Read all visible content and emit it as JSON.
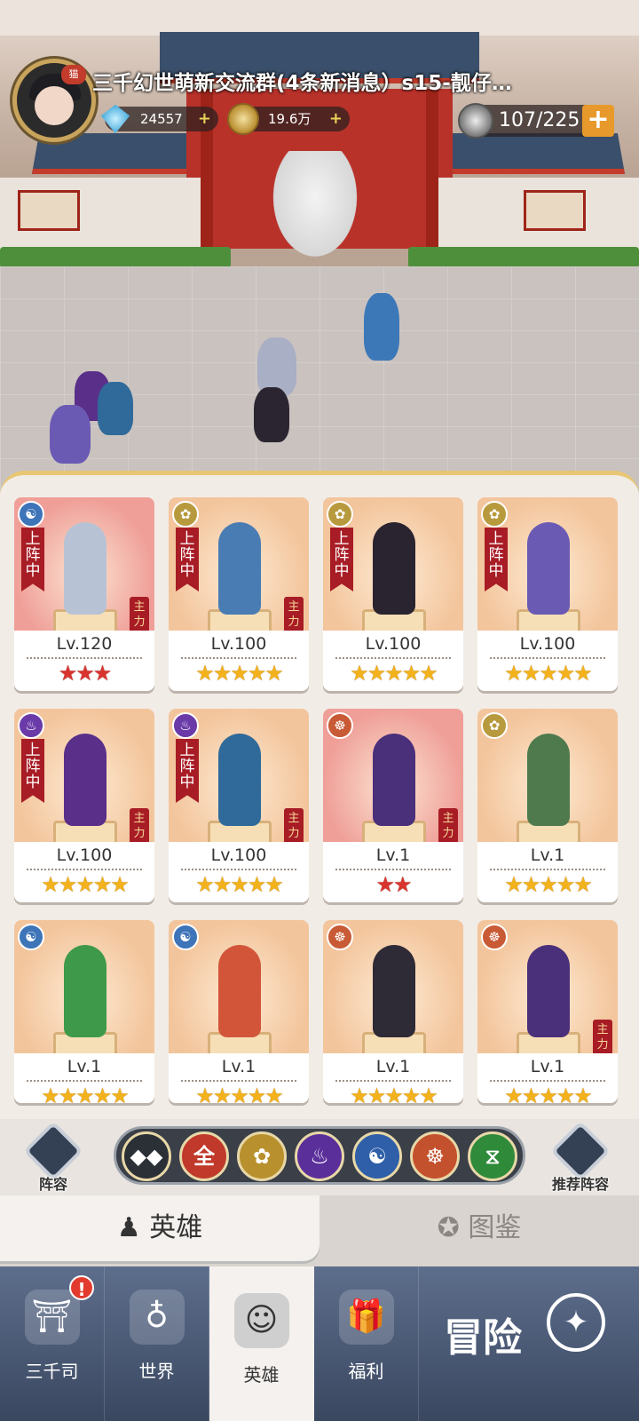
{
  "header": {
    "chat_banner": "三千幻世萌新交流群(4条新消息）s15-靓仔…",
    "profile_badge": "猫",
    "gems": "24557",
    "coins": "19.6万",
    "stamina": "107/225",
    "plus": "+"
  },
  "heroes": [
    {
      "element": "water",
      "element_glyph": "☯",
      "deployed": true,
      "deployed_label": "上阵中",
      "main": true,
      "main_label": "主力",
      "level": "Lv.120",
      "stars": "★★★",
      "star_color": "red",
      "highlight": "pink",
      "hero_color": "#b7c3d4"
    },
    {
      "element": "lotus",
      "element_glyph": "✿",
      "deployed": true,
      "deployed_label": "上阵中",
      "main": true,
      "main_label": "主力",
      "level": "Lv.100",
      "stars": "★★★★★",
      "star_color": "gold",
      "highlight": "orange",
      "hero_color": "#4a7cb4"
    },
    {
      "element": "lotus",
      "element_glyph": "✿",
      "deployed": true,
      "deployed_label": "上阵中",
      "main": false,
      "main_label": "",
      "level": "Lv.100",
      "stars": "★★★★★",
      "star_color": "gold",
      "highlight": "orange",
      "hero_color": "#2a2330"
    },
    {
      "element": "lotus",
      "element_glyph": "✿",
      "deployed": true,
      "deployed_label": "上阵中",
      "main": false,
      "main_label": "",
      "level": "Lv.100",
      "stars": "★★★★★",
      "star_color": "gold",
      "highlight": "orange",
      "hero_color": "#6a5ab4"
    },
    {
      "element": "fire",
      "element_glyph": "♨",
      "deployed": true,
      "deployed_label": "上阵中",
      "main": true,
      "main_label": "主力",
      "level": "Lv.100",
      "stars": "★★★★★",
      "star_color": "gold",
      "highlight": "orange",
      "hero_color": "#5a2f8a"
    },
    {
      "element": "fire",
      "element_glyph": "♨",
      "deployed": true,
      "deployed_label": "上阵中",
      "main": true,
      "main_label": "主力",
      "level": "Lv.100",
      "stars": "★★★★★",
      "star_color": "gold",
      "highlight": "orange",
      "hero_color": "#2f6a9a"
    },
    {
      "element": "monk",
      "element_glyph": "☸",
      "deployed": false,
      "deployed_label": "",
      "main": true,
      "main_label": "主力",
      "level": "Lv.1",
      "stars": "★★",
      "star_color": "red",
      "highlight": "pink",
      "hero_color": "#4a2f7a"
    },
    {
      "element": "lotus",
      "element_glyph": "✿",
      "deployed": false,
      "deployed_label": "",
      "main": false,
      "main_label": "",
      "level": "Lv.1",
      "stars": "★★★★★",
      "star_color": "gold",
      "highlight": "orange",
      "hero_color": "#4e7a4e"
    },
    {
      "element": "water",
      "element_glyph": "☯",
      "deployed": false,
      "deployed_label": "",
      "main": false,
      "main_label": "",
      "level": "Lv.1",
      "stars": "★★★★★",
      "star_color": "gold",
      "highlight": "orange",
      "hero_color": "#3e9a4a"
    },
    {
      "element": "water",
      "element_glyph": "☯",
      "deployed": false,
      "deployed_label": "",
      "main": false,
      "main_label": "",
      "level": "Lv.1",
      "stars": "★★★★★",
      "star_color": "gold",
      "highlight": "orange",
      "hero_color": "#d2553a"
    },
    {
      "element": "monk",
      "element_glyph": "☸",
      "deployed": false,
      "deployed_label": "",
      "main": false,
      "main_label": "",
      "level": "Lv.1",
      "stars": "★★★★★",
      "star_color": "gold",
      "highlight": "orange",
      "hero_color": "#2e2a36"
    },
    {
      "element": "monk",
      "element_glyph": "☸",
      "deployed": false,
      "deployed_label": "",
      "main": true,
      "main_label": "主力",
      "level": "Lv.1",
      "stars": "★★★★★",
      "star_color": "gold",
      "highlight": "orange",
      "hero_color": "#4a2f7a"
    }
  ],
  "filter": {
    "formation_label": "阵容",
    "recommend_label": "推荐阵容",
    "buttons": [
      {
        "name": "filter-faction-button",
        "glyph": "◆◆",
        "color": "#2b2f36"
      },
      {
        "name": "filter-all-button",
        "glyph": "全",
        "color": "#c0392b"
      },
      {
        "name": "filter-lotus-button",
        "glyph": "✿",
        "color": "#b8912e"
      },
      {
        "name": "filter-fire-button",
        "glyph": "♨",
        "color": "#5a2f9a"
      },
      {
        "name": "filter-water-button",
        "glyph": "☯",
        "color": "#2e5fa8"
      },
      {
        "name": "filter-monk-button",
        "glyph": "☸",
        "color": "#c4512d"
      },
      {
        "name": "filter-dna-button",
        "glyph": "⧖",
        "color": "#2f8a3a"
      }
    ]
  },
  "tabs": {
    "heroes_label": "英雄",
    "codex_label": "图鉴"
  },
  "nav": {
    "items": [
      {
        "label": "三千司",
        "glyph": "⛩"
      },
      {
        "label": "世界",
        "glyph": "♁"
      },
      {
        "label": "英雄",
        "glyph": "☺"
      },
      {
        "label": "福利",
        "glyph": "🎁"
      }
    ],
    "alert": "!",
    "adventure_label": "冒险",
    "compass_glyph": "✦"
  },
  "colors": {
    "accent_gold": "#e8c774",
    "deploy_red": "#a81c25",
    "nav_blue": "#4a5a78"
  }
}
